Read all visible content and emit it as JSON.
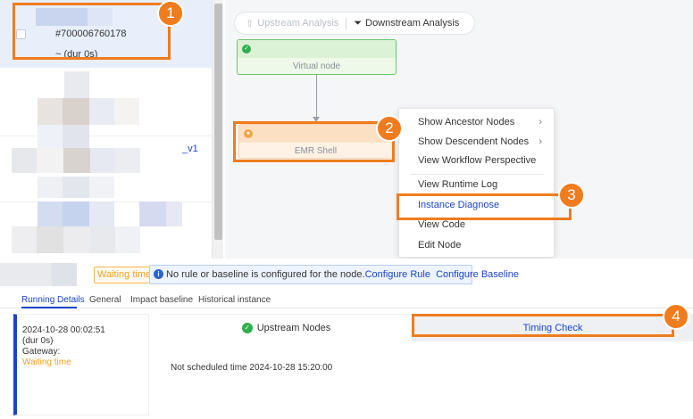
{
  "instance_list": {
    "selected_row": {
      "id": "#700006760178",
      "duration": "~ (dur 0s)"
    },
    "row_name_suffix": "_v1"
  },
  "dag": {
    "toolbar": {
      "upstream": "Upstream Analysis",
      "downstream": "Downstream Analysis"
    },
    "nodes": [
      {
        "label": "Virtual node",
        "status": "success"
      },
      {
        "label": "EMR Shell",
        "status": "waiting"
      }
    ]
  },
  "context_menu": {
    "items": [
      {
        "label": "Show Ancestor Nodes",
        "submenu": true
      },
      {
        "label": "Show Descendent Nodes",
        "submenu": true
      },
      {
        "label": "View Workflow Perspective",
        "submenu": false
      },
      {
        "label": "View Runtime Log",
        "submenu": false
      },
      {
        "label": "Instance Diagnose",
        "submenu": false
      },
      {
        "label": "View Code",
        "submenu": false
      },
      {
        "label": "Edit Node",
        "submenu": false
      }
    ]
  },
  "annotations": [
    "1",
    "2",
    "3",
    "4"
  ],
  "detail": {
    "status_badge": "Waiting time",
    "info_text": "No rule or baseline is configured for the node.",
    "configure_rule": "Configure Rule",
    "configure_baseline": "Configure Baseline",
    "tabs": [
      "Running Details",
      "General",
      "Impact baseline",
      "Historical instance"
    ],
    "run": {
      "time": "2024-10-28 00:02:51",
      "duration": "(dur 0s)",
      "gateway": "Gateway:",
      "status": "Waiting time"
    },
    "check_tabs": {
      "upstream": "Upstream Nodes",
      "timing": "Timing Check"
    },
    "timing_body": "Not scheduled time 2024-10-28 15:20:00"
  },
  "colors": {
    "accent": "#1a44c8",
    "annotation": "#f07c1e",
    "success": "#2fae4e",
    "waiting": "#f0a020"
  }
}
